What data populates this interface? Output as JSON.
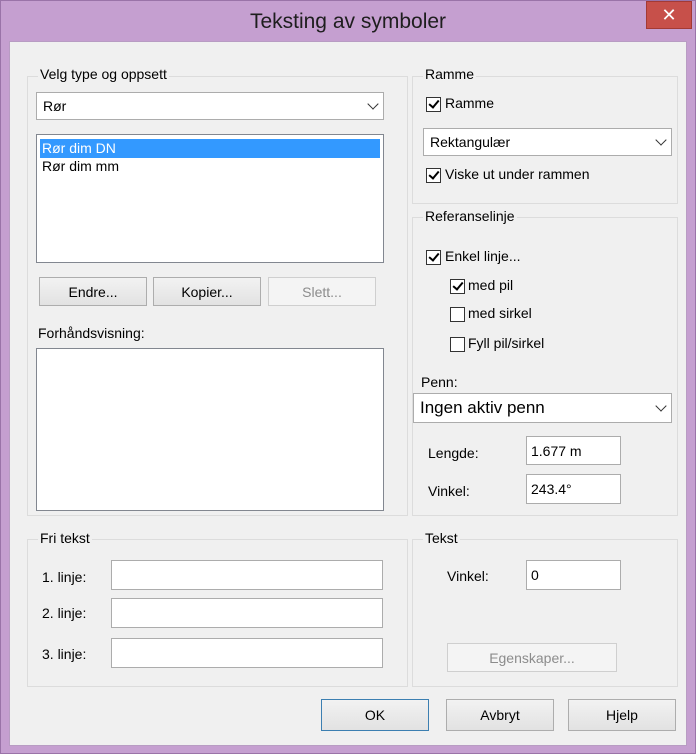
{
  "window": {
    "title": "Teksting av symboler",
    "close_glyph": "✕"
  },
  "type_group": {
    "label": "Velg type og oppsett",
    "selected_type": "Rør",
    "items": [
      "Rør dim DN",
      "Rør dim mm"
    ],
    "selected_index": 0,
    "buttons": {
      "edit": "Endre...",
      "copy": "Kopier...",
      "delete": "Slett..."
    },
    "preview_label": "Forhåndsvisning:"
  },
  "frame_group": {
    "label": "Ramme",
    "frame_checkbox": {
      "label": "Ramme",
      "checked": true
    },
    "shape_value": "Rektangulær",
    "erase_checkbox": {
      "label": "Viske ut under rammen",
      "checked": true
    }
  },
  "refline_group": {
    "label": "Referanselinje",
    "single_line": {
      "label": "Enkel linje...",
      "checked": true
    },
    "with_arrow": {
      "label": "med pil",
      "checked": true
    },
    "with_circle": {
      "label": "med sirkel",
      "checked": false
    },
    "fill": {
      "label": "Fyll pil/sirkel",
      "checked": false
    },
    "pen_label": "Penn:",
    "pen_value": "Ingen aktiv penn",
    "length_label": "Lengde:",
    "length_value": "1.677 m",
    "angle_label": "Vinkel:",
    "angle_value": "243.4°"
  },
  "free_text_group": {
    "label": "Fri tekst",
    "line1_label": "1. linje:",
    "line2_label": "2. linje:",
    "line3_label": "3. linje:",
    "line1_value": "",
    "line2_value": "",
    "line3_value": ""
  },
  "text_group": {
    "label": "Tekst",
    "angle_label": "Vinkel:",
    "angle_value": "0",
    "properties_button": "Egenskaper..."
  },
  "footer": {
    "ok": "OK",
    "cancel": "Avbryt",
    "help": "Hjelp"
  },
  "colors": {
    "title_bar": "#c59fd0",
    "close": "#c7504a",
    "selection": "#3399ff",
    "dialog_bg": "#f0f0f0"
  }
}
